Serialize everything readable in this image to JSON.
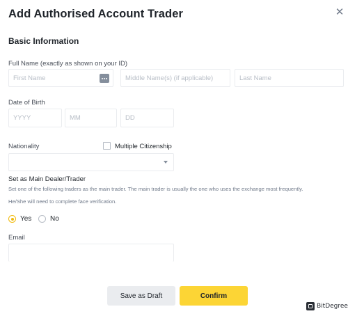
{
  "modal": {
    "title": "Add Authorised Account Trader",
    "close_icon": "close-icon"
  },
  "basic_info": {
    "section_title": "Basic Information",
    "full_name_label": "Full Name (exactly as shown on your ID)",
    "first_name_placeholder": "First Name",
    "middle_name_placeholder": "Middle Name(s) (if applicable)",
    "last_name_placeholder": "Last Name",
    "id_card_icon": "id-card-icon",
    "dob_label": "Date of Birth",
    "dob_year_placeholder": "YYYY",
    "dob_month_placeholder": "MM",
    "dob_day_placeholder": "DD",
    "nationality_label": "Nationality",
    "multiple_citizenship_label": "Multiple Citizenship",
    "multiple_citizenship_checked": false,
    "nationality_selected": "",
    "main_trader_label": "Set as Main Dealer/Trader",
    "main_trader_desc_line1": "Set one of the following traders as the main trader. The main trader is usually the one who uses the exchange most frequently.",
    "main_trader_desc_line2": "He/She will need to complete face verification.",
    "radio_yes": "Yes",
    "radio_no": "No",
    "selected_option": "Yes",
    "email_label": "Email",
    "email_value": ""
  },
  "footer": {
    "save_draft_label": "Save as Draft",
    "confirm_label": "Confirm"
  },
  "watermark": {
    "text": "BitDegree"
  },
  "colors": {
    "accent": "#fcd535",
    "radio_accent": "#f0b90b",
    "border": "#eaecef",
    "text_primary": "#1e2329",
    "text_secondary": "#707a8a"
  }
}
